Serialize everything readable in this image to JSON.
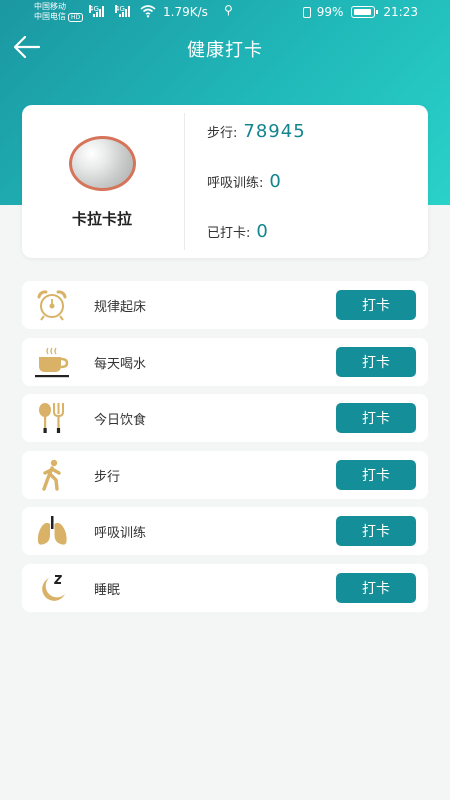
{
  "status_bar": {
    "carrier1": "中国移动",
    "carrier2": "中国电信",
    "hd_badge": "HD",
    "network_type": "4G",
    "speed": "1.79K/s",
    "battery": "99%",
    "time": "21:23"
  },
  "header": {
    "back_icon": "arrow-left-icon",
    "title": "健康打卡"
  },
  "profile": {
    "name": "卡拉卡拉",
    "stats": [
      {
        "label": "步行:",
        "value": "78945"
      },
      {
        "label": "呼吸训练:",
        "value": "0"
      },
      {
        "label": "已打卡:",
        "value": "0"
      }
    ]
  },
  "tasks": [
    {
      "icon": "alarm-clock-icon",
      "label": "规律起床",
      "button": "打卡"
    },
    {
      "icon": "coffee-cup-icon",
      "label": "每天喝水",
      "button": "打卡"
    },
    {
      "icon": "spoon-fork-icon",
      "label": "今日饮食",
      "button": "打卡"
    },
    {
      "icon": "walking-person-icon",
      "label": "步行",
      "button": "打卡"
    },
    {
      "icon": "lungs-icon",
      "label": "呼吸训练",
      "button": "打卡"
    },
    {
      "icon": "moon-sleep-icon",
      "label": "睡眠",
      "button": "打卡"
    }
  ],
  "colors": {
    "header_gradient_start": "#1b97a2",
    "header_gradient_end": "#2ad2c9",
    "accent": "#148e98",
    "stat_value": "#13858e",
    "icon": "#d9b268"
  }
}
